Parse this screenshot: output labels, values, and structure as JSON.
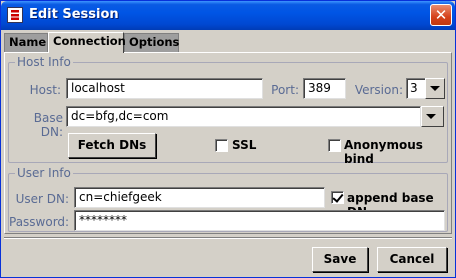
{
  "window": {
    "title": "Edit Session",
    "close_glyph": "✕"
  },
  "tabs": [
    {
      "label": "Name",
      "active": false
    },
    {
      "label": "Connection",
      "active": true
    },
    {
      "label": "Options",
      "active": false
    }
  ],
  "host_info": {
    "group_title": "Host Info",
    "host_label": "Host:",
    "host_value": "localhost",
    "port_label": "Port:",
    "port_value": "389",
    "version_label": "Version:",
    "version_value": "3",
    "base_dn_label": "Base DN:",
    "base_dn_value": "dc=bfg,dc=com",
    "fetch_button": "Fetch DNs",
    "ssl_label": "SSL",
    "ssl_checked": false,
    "anon_label": "Anonymous bind",
    "anon_checked": false
  },
  "user_info": {
    "group_title": "User Info",
    "user_dn_label": "User DN:",
    "user_dn_value": "cn=chiefgeek",
    "append_label": "append base DN",
    "append_checked": true,
    "password_label": "Password:",
    "password_value": "********"
  },
  "footer": {
    "save_label": "Save",
    "cancel_label": "Cancel"
  },
  "colors": {
    "title_bar": "#0055E5",
    "label_text": "#5A6B94",
    "dialog_bg": "#D4D0C8"
  }
}
